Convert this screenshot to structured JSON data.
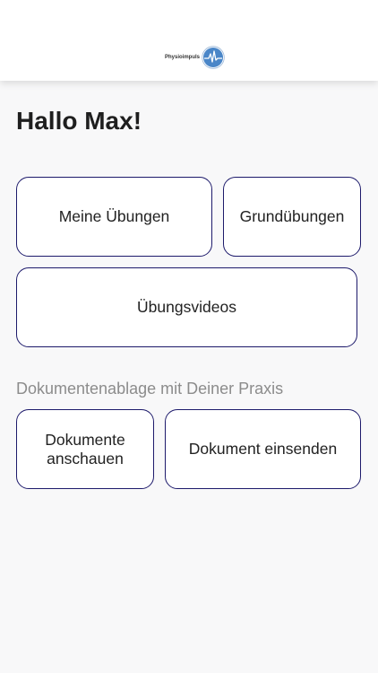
{
  "header": {
    "logo_text": "Physioimpuls",
    "logo_accent_color": "#4a86c8"
  },
  "greeting": "Hallo Max!",
  "tiles_primary": {
    "meine_uebungen": "Meine Übungen",
    "grunduebungen": "Grundübungen",
    "uebungsvideos": "Übungsvideos"
  },
  "documents": {
    "section_label": "Dokumentenablage mit Deiner Praxis",
    "anschauen_line1": "Dokumente",
    "anschauen_line2": "anschauen",
    "einsenden": "Dokument einsenden"
  },
  "colors": {
    "tile_border": "#1d1a6b",
    "background": "#f8f8f9"
  }
}
